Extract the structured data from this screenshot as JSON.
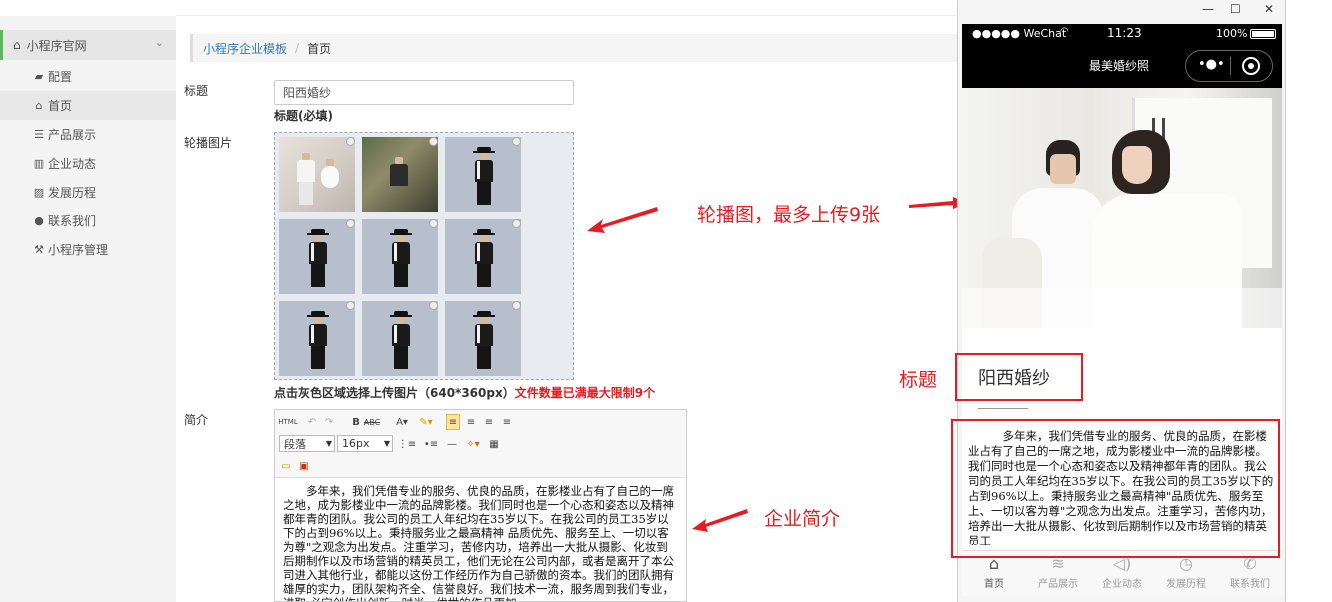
{
  "sidebar": {
    "section": "小程序官网",
    "items": [
      {
        "label": "配置",
        "icon": "briefcase-icon",
        "glyph": "▰"
      },
      {
        "label": "首页",
        "icon": "home-icon",
        "glyph": "⌂"
      },
      {
        "label": "产品展示",
        "icon": "list-icon",
        "glyph": "☰"
      },
      {
        "label": "企业动态",
        "icon": "barcode-icon",
        "glyph": "▥"
      },
      {
        "label": "发展历程",
        "icon": "picture-icon",
        "glyph": "▨"
      },
      {
        "label": "联系我们",
        "icon": "user-icon",
        "glyph": "●"
      },
      {
        "label": "小程序管理",
        "icon": "wrench-icon",
        "glyph": "⚒"
      }
    ]
  },
  "breadcrumb": {
    "root": "小程序企业模板",
    "current": "首页"
  },
  "form": {
    "title_label": "标题",
    "title_value": "阳西婚纱",
    "title_hint": "标题(必填)",
    "carousel_label": "轮播图片",
    "upload_hint": "点击灰色区域选择上传图片（640*360px）",
    "upload_limit": "文件数量已满最大限制9个",
    "intro_label": "简介"
  },
  "editor": {
    "paragraph_select": "段落",
    "size_select": "16px",
    "content": "多年来，我们凭借专业的服务、优良的品质，在影楼业占有了自己的一席之地，成为影楼业中一流的品牌影楼。我们同时也是一个心态和姿态以及精神都年青的团队。我公司的员工人年纪均在35岁以下。在我公司的员工35岁以下的占到96%以上。秉持服务业之最高精神 品质优先、服务至上、一切以客为尊\"之观念为出发点。注重学习，苦修内功，培养出一大批从摄影、化妆到后期制作以及市场营销的精英员工，他们无论在公司内部，或者是离开了本公司进入其他行业，都能以这份工作经历作为自己骄傲的资本。我们的团队拥有雄厚的实力，团队架构齐全、信誉良好。我们技术一流，服务周到我们专业，进取,必定创作出创新、时尚、优世的作品更加"
  },
  "phone": {
    "carrier": "●●●●● WeChat",
    "time": "11:23",
    "battery": "100%",
    "nav_title": "最美婚纱照",
    "page_title": "阳西婚纱",
    "content": "多年来，我们凭借专业的服务、优良的品质，在影楼业占有了自己的一席之地，成为影楼业中一流的品牌影楼。我们同时也是一个心态和姿态以及精神都年青的团队。我公司的员工人年纪均在35岁以下。在我公司的员工35岁以下的占到96%以上。秉持服务业之最高精神\"品质优先、服务至上、一切以客为尊\"之观念为出发点。注重学习，苦修内功，培养出一大批从摄影、化妆到后期制作以及市场营销的精英员工",
    "tabs": [
      {
        "label": "首页",
        "icon": "home-icon",
        "glyph": "⌂"
      },
      {
        "label": "产品展示",
        "icon": "layers-icon",
        "glyph": "≋"
      },
      {
        "label": "企业动态",
        "icon": "speaker-icon",
        "glyph": "◁)"
      },
      {
        "label": "发展历程",
        "icon": "clock-icon",
        "glyph": "◷"
      },
      {
        "label": "联系我们",
        "icon": "phone-icon",
        "glyph": "✆"
      }
    ]
  },
  "annotations": {
    "carousel": "轮播图，最多上传9张",
    "title": "标题",
    "intro": "企业简介"
  },
  "colors": {
    "accent": "#337ab7",
    "annotation_red": "#e51c23",
    "sidebar_marker": "#5cb85c"
  }
}
